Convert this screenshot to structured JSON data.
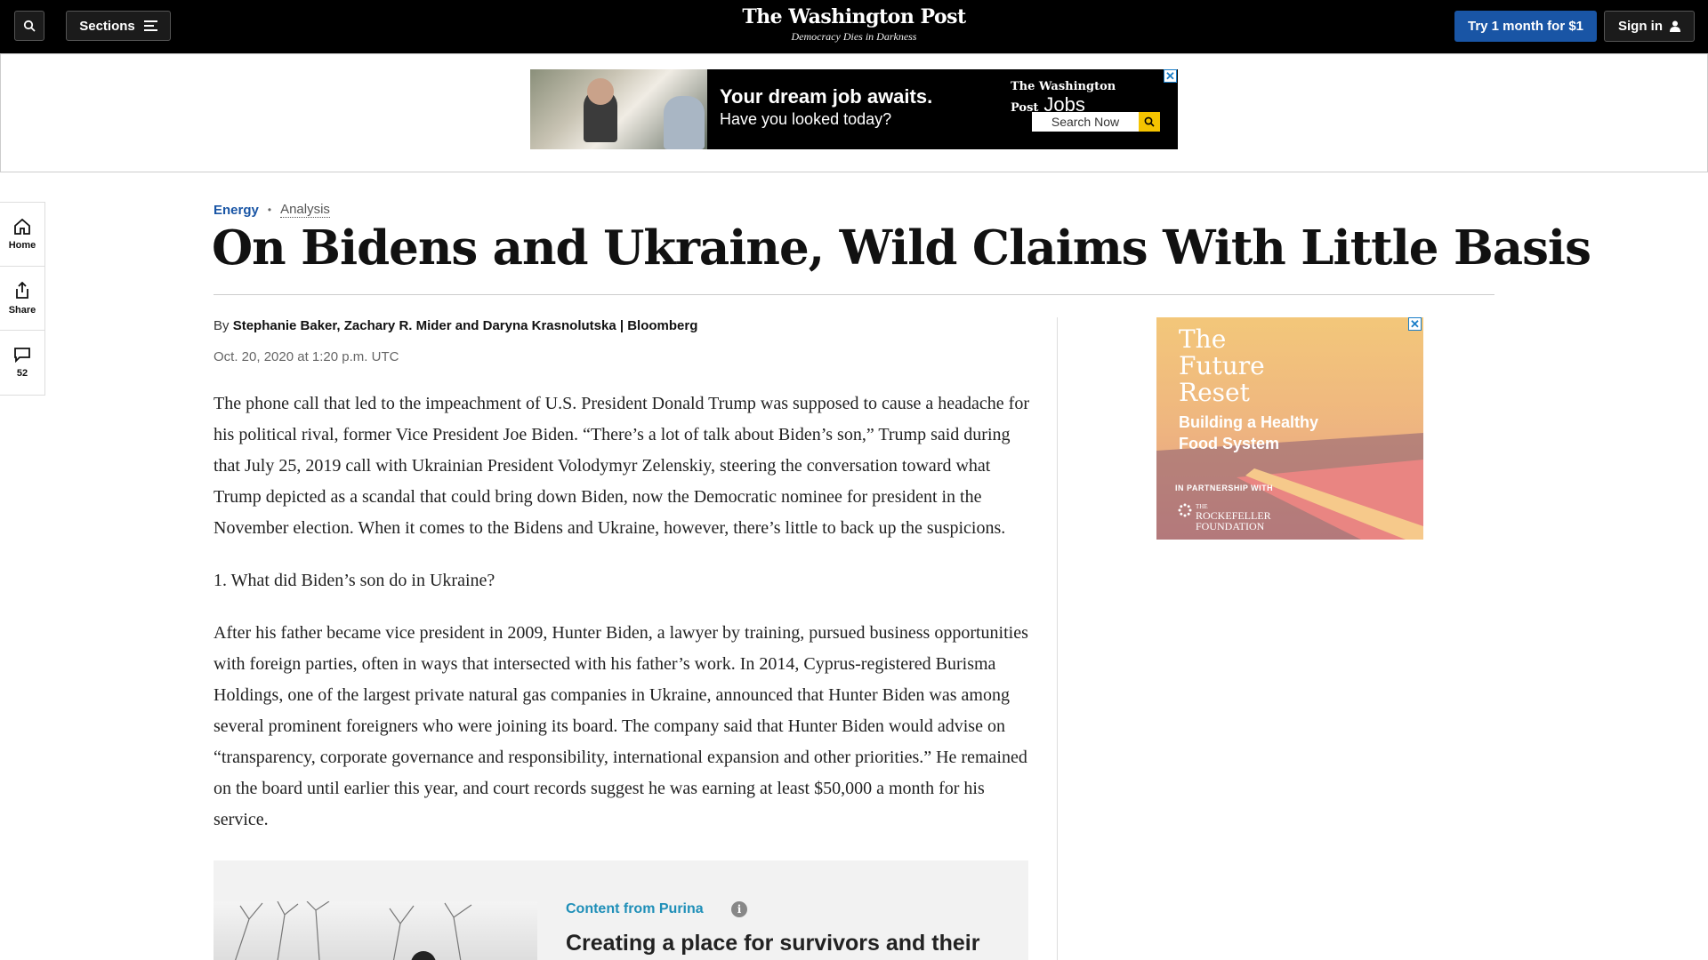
{
  "header": {
    "sections_label": "Sections",
    "logo": "The Washington Post",
    "tagline": "Democracy Dies in Darkness",
    "subscribe_label": "Try 1 month for $1",
    "signin_label": "Sign in"
  },
  "top_ad": {
    "headline": "Your dream job awaits.",
    "subline": "Have you looked today?",
    "brand": "The Washington Post",
    "brand_suffix": "Jobs",
    "search_label": "Search Now"
  },
  "rail": {
    "home_label": "Home",
    "share_label": "Share",
    "comments_count": "52"
  },
  "article": {
    "category": "Energy",
    "label": "Analysis",
    "headline": "On Bidens and Ukraine, Wild Claims With Little Basis",
    "by_prefix": "By",
    "authors": "Stephanie Baker, Zachary R. Mider and Daryna Krasnolutska | Bloomberg",
    "date": "Oct. 20, 2020 at 1:20 p.m. UTC",
    "paragraphs": [
      "The phone call that led to the impeachment of U.S. President Donald Trump was supposed to cause a headache for his political rival, former Vice President Joe Biden. “There’s a lot of talk about Biden’s son,” Trump said during that July 25, 2019 call with Ukrainian President Volodymyr Zelenskiy, steering the conversation toward what Trump depicted as a scandal that could bring down Biden, now the Democratic nominee for president in the November election. When it comes to the Bidens and Ukraine, however, there’s little to back up the suspicions.",
      "1. What did Biden’s son do in Ukraine?",
      "After his father became vice president in 2009, Hunter Biden, a lawyer by training, pursued business opportunities with foreign parties, often in ways that intersected with his father’s work. In 2014, Cyprus-registered Burisma Holdings, one of the largest private natural gas companies in Ukraine, announced that Hunter Biden was among several prominent foreigners who were joining its board. The company said that Hunter Biden would advise on “transparency, corporate governance and responsibility, international expansion and other priorities.” He remained on the board until earlier this year, and court records suggest he was earning at least $50,000 a month for his service."
    ]
  },
  "sponsored": {
    "label": "Content from Purina",
    "info": "i",
    "title": "Creating a place for survivors and their pets to heal"
  },
  "side_ad": {
    "line1": "The",
    "line2": "Future",
    "line3": "Reset",
    "sub1": "Building a Healthy",
    "sub2": "Food System",
    "partner": "IN PARTNERSHIP WITH",
    "org1": "THE",
    "org2": "ROCKEFELLER",
    "org3": "FOUNDATION"
  },
  "colors": {
    "accent_blue": "#1955a5",
    "sponsor_teal": "#1f8fb8"
  }
}
